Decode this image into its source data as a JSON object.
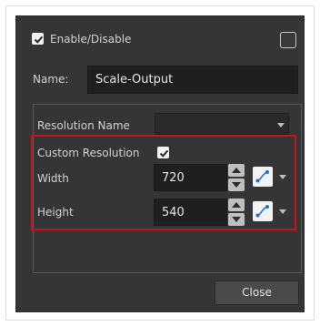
{
  "dialog": {
    "enable_label": "Enable/Disable",
    "enable_checked": true,
    "name_label": "Name:",
    "name_value": "Scale-Output",
    "resolution_name_label": "Resolution Name",
    "resolution_name_value": "",
    "custom_resolution_label": "Custom Resolution",
    "custom_resolution_checked": true,
    "width_label": "Width",
    "width_value": "720",
    "height_label": "Height",
    "height_value": "540",
    "close_label": "Close"
  },
  "icons": {
    "spin_up": "spin-up-icon",
    "spin_down": "spin-down-icon",
    "function_curve": "function-curve-icon",
    "dropdown": "chevron-down-icon",
    "checkmark": "checkmark-icon"
  },
  "colors": {
    "dialog_bg": "#353535",
    "field_bg": "#1f1f1f",
    "highlight": "#c8151b",
    "function_curve_blue": "#1e6fd9"
  }
}
